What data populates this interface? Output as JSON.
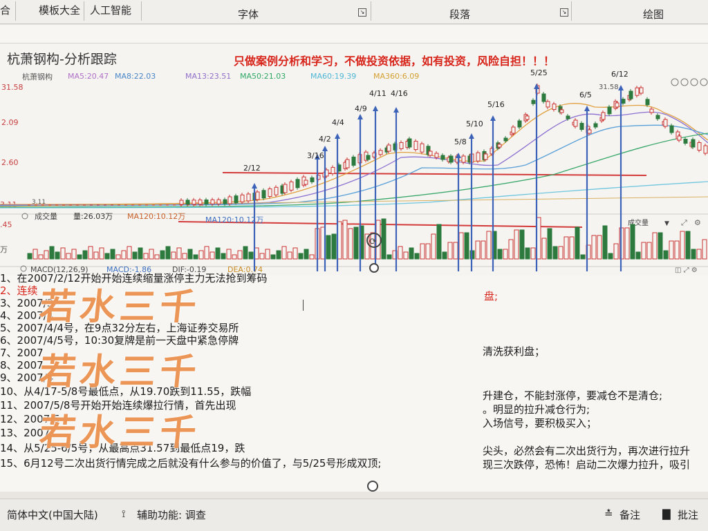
{
  "ribbon": {
    "items": [
      {
        "label": "合"
      },
      {
        "label": "模板大全"
      },
      {
        "label": "人工智能"
      }
    ],
    "groups": [
      {
        "label": "字体"
      },
      {
        "label": "段落"
      },
      {
        "label": "绘图"
      }
    ]
  },
  "chart": {
    "title": "杭萧钢构-分析跟踪",
    "disclaimer": "只做案例分析和学习，不做投资依据，如有投资，风险自担！！！",
    "stock_name": "杭萧钢构",
    "ma": [
      {
        "label": "MA5:20.47",
        "color": "#c98bd8"
      },
      {
        "label": "MA8:22.03",
        "color": "#5a9bd8"
      },
      {
        "label": "MA13:23.51",
        "color": "#a78ad9"
      },
      {
        "label": "MA50:21.03",
        "color": "#43b37a"
      },
      {
        "label": "MA60:19.39",
        "color": "#69c3e0"
      },
      {
        "label": "MA360:6.09",
        "color": "#e0b040"
      }
    ],
    "y_labels": [
      "31.58",
      "2.09",
      "2.60",
      "3.11",
      ".45",
      "万"
    ],
    "high_label": "31.58",
    "low_label": "3.11",
    "volume_header": {
      "title": "成交量",
      "vol": "量:26.03万",
      "ma120_1": "MA120:10.12万",
      "ma120_2": "MA120:10.12万",
      "dropdown": "成交量"
    },
    "macd_header": {
      "macd": "MACD(12,26,9)",
      "macd_val": "MACD:-1.86",
      "dif": "DIF:-0.19",
      "dea": "DEA:0.74"
    },
    "dates": [
      "2/12",
      "3/16",
      "4/2",
      "4/4",
      "4/9",
      "4/11",
      "4/16",
      "5/8",
      "5/10",
      "5/16",
      "5/25",
      "6/5",
      "6/12"
    ]
  },
  "text_lines": [
    {
      "text": "1、在2007/2/12开始开始连续缩量涨停主力无法抢到筹码",
      "red": false
    },
    {
      "text": "2、连续",
      "red": true
    },
    {
      "text": "3、2007/3",
      "red": false
    },
    {
      "text": "4、2007/4",
      "red": false
    },
    {
      "text": "5、2007/4/4号，在9点32分左右，上海证券交易所",
      "red": false
    },
    {
      "text": "6、2007/4/5号，10:30复牌是前一天盘中紧急停牌",
      "red": false
    },
    {
      "text": "7、2007",
      "red": false
    },
    {
      "text": "8、2007",
      "red": false
    },
    {
      "text": "9、2007/4",
      "red": false
    },
    {
      "text": "10、从4/17-5/8号最低点，从19.70跌到11.55，跌幅",
      "red": false
    },
    {
      "text": "11、2007/5/8号开始开始连续爆拉行情，首先出现",
      "red": false
    },
    {
      "text": "12、2007/5",
      "red": false
    },
    {
      "text": "13、2007",
      "red": false
    },
    {
      "text": "14、从5/25-6/5号，从最高点31.57到最低点19，跌",
      "red": false
    },
    {
      "text": "15、6月12号二次出货行情完成之后就没有什么参与的价值了，与5/25号形成双顶;",
      "red": false
    }
  ],
  "right_fragments": [
    {
      "text": "盘;",
      "red": true
    },
    {
      "text": "清洗获利盘；",
      "red": false
    },
    {
      "text": "升建仓，不能封涨停，要减仓不是清仓;",
      "red": false
    },
    {
      "text": "。明显的拉升减仓行为;",
      "red": false
    },
    {
      "text": "入场信号，要积极买入；",
      "red": false
    },
    {
      "text": "尖头，必然会有二次出货行为，再次进行拉升",
      "red": false
    },
    {
      "text": "现三次跌停，恐怖！启动二次爆力拉升，吸引",
      "red": false
    }
  ],
  "watermark": "若水三千",
  "statusbar": {
    "language": "简体中文(中国大陆)",
    "accessibility": "辅助功能: 调查",
    "notes": "备注",
    "comments": "批注"
  }
}
